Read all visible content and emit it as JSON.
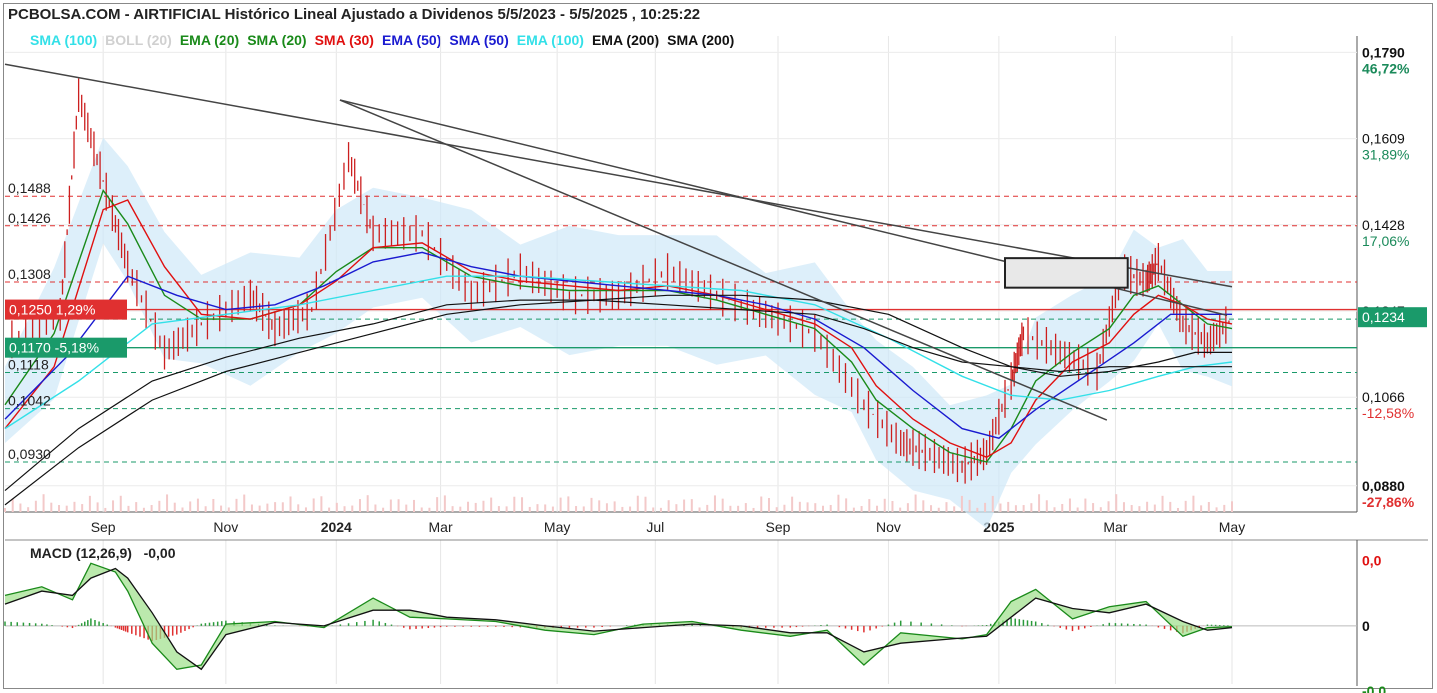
{
  "header": {
    "title": "PCBOLSA.COM - AIRTIFICIAL Histórico Lineal Ajustado a Dividenos 5/5/2023 - 5/5/2025 , 10:25:22"
  },
  "legend": [
    {
      "label": "SMA (100)",
      "color": "#33e0e8"
    },
    {
      "label": "BOLL (20)",
      "color": "#d0d0d0"
    },
    {
      "label": "EMA (20)",
      "color": "#1a8a1a"
    },
    {
      "label": "SMA (20)",
      "color": "#1a8a1a"
    },
    {
      "label": "SMA (30)",
      "color": "#e01010"
    },
    {
      "label": "EMA (50)",
      "color": "#1a1ad0"
    },
    {
      "label": "SMA (50)",
      "color": "#1a1ad0"
    },
    {
      "label": "EMA (100)",
      "color": "#33e0e8"
    },
    {
      "label": "EMA (200)",
      "color": "#111111"
    },
    {
      "label": "SMA (200)",
      "color": "#111111"
    }
  ],
  "macd": {
    "label": "MACD (12,26,9)",
    "value": "-0,00",
    "axis": [
      {
        "text": "0,0",
        "color": "#e01010",
        "level": 1
      },
      {
        "text": "0",
        "color": "#111111",
        "level": 0
      },
      {
        "text": "-0,0",
        "color": "#1a8a1a",
        "level": -1
      }
    ]
  },
  "chart_data": {
    "type": "line",
    "x_ticks": [
      "Sep",
      "Nov",
      "2024",
      "Mar",
      "May",
      "Jul",
      "Sep",
      "Nov",
      "2025",
      "Mar",
      "May"
    ],
    "x_tick_bold": [
      false,
      false,
      true,
      false,
      false,
      false,
      false,
      false,
      true,
      false,
      false
    ],
    "ylim": [
      0.0825,
      0.1795
    ],
    "right_labels": [
      {
        "value": 0.179,
        "text": "0,1790",
        "pct": "46,72%",
        "pct_color": "#1a8a5a"
      },
      {
        "value": 0.1609,
        "text": "0,1609",
        "pct": "31,89%",
        "pct_color": "#1a8a5a"
      },
      {
        "value": 0.1428,
        "text": "0,1428",
        "pct": "17,06%",
        "pct_color": "#1a8a5a"
      },
      {
        "value": 0.1247,
        "text": "0,1247",
        "pct": "",
        "pct_color": "#1a8a5a"
      },
      {
        "value": 0.1066,
        "text": "0,1066",
        "pct": "-12,58%",
        "pct_color": "#e03030"
      },
      {
        "value": 0.088,
        "text": "0,0880",
        "pct": "-27,86%",
        "pct_color": "#e03030"
      }
    ],
    "left_levels": [
      {
        "value": 0.1488,
        "text": "0,1488"
      },
      {
        "value": 0.1426,
        "text": "0,1426"
      },
      {
        "value": 0.1308,
        "text": "0,1308"
      },
      {
        "value": 0.1118,
        "text": "0,1118"
      },
      {
        "value": 0.1042,
        "text": "0,1042"
      },
      {
        "value": 0.093,
        "text": "0,0930"
      }
    ],
    "resistance_lines": [
      0.1488,
      0.1426,
      0.1308
    ],
    "support_lines": [
      0.123,
      0.1118,
      0.1042,
      0.093
    ],
    "current": {
      "value": 0.1234,
      "text": "0,1234",
      "color": "#1a9a6a"
    },
    "red_level": {
      "value": 0.125,
      "text": "0,1250 1,29%",
      "color": "#e03030"
    },
    "green_level": {
      "value": 0.117,
      "text": "0,1170 -5,18%",
      "color": "#1a9a6a"
    },
    "trendlines": [
      {
        "x": [
          0.0,
          1.0
        ],
        "y": [
          0.1765,
          0.1298
        ]
      },
      {
        "x": [
          0.273,
          0.898
        ],
        "y": [
          0.169,
          0.1018
        ]
      },
      {
        "x": [
          0.273,
          0.996
        ],
        "y": [
          0.169,
          0.1238
        ]
      }
    ],
    "box": {
      "x": [
        0.815,
        0.915
      ],
      "y": [
        0.1358,
        0.1296
      ]
    },
    "series": [
      {
        "name": "Precio",
        "kind": "price",
        "color": "#cc1f1f",
        "x": [
          0.0,
          0.045,
          0.06,
          0.08,
          0.1,
          0.13,
          0.16,
          0.2,
          0.22,
          0.25,
          0.28,
          0.3,
          0.34,
          0.38,
          0.42,
          0.46,
          0.5,
          0.54,
          0.58,
          0.62,
          0.66,
          0.7,
          0.73,
          0.75,
          0.78,
          0.8,
          0.82,
          0.83,
          0.86,
          0.89,
          0.91,
          0.93,
          0.94,
          0.96,
          0.98,
          1.0
        ],
        "y": [
          0.118,
          0.124,
          0.17,
          0.152,
          0.134,
          0.116,
          0.122,
          0.128,
          0.121,
          0.125,
          0.157,
          0.141,
          0.141,
          0.128,
          0.133,
          0.128,
          0.128,
          0.133,
          0.128,
          0.124,
          0.12,
          0.105,
          0.097,
          0.095,
          0.092,
          0.095,
          0.11,
          0.12,
          0.116,
          0.112,
          0.133,
          0.131,
          0.135,
          0.122,
          0.118,
          0.123
        ]
      },
      {
        "name": "EMA (20)",
        "kind": "ma",
        "color": "#1a8a1a",
        "width": 1.4,
        "x": [
          0.0,
          0.04,
          0.08,
          0.1,
          0.13,
          0.16,
          0.2,
          0.24,
          0.27,
          0.3,
          0.34,
          0.38,
          0.42,
          0.46,
          0.5,
          0.54,
          0.58,
          0.62,
          0.66,
          0.69,
          0.71,
          0.74,
          0.77,
          0.8,
          0.82,
          0.84,
          0.87,
          0.9,
          0.92,
          0.94,
          0.96,
          0.98,
          1.0
        ],
        "y": [
          0.105,
          0.12,
          0.15,
          0.143,
          0.128,
          0.123,
          0.123,
          0.126,
          0.133,
          0.138,
          0.138,
          0.132,
          0.13,
          0.129,
          0.129,
          0.129,
          0.127,
          0.124,
          0.121,
          0.114,
          0.106,
          0.1,
          0.095,
          0.093,
          0.1,
          0.11,
          0.116,
          0.121,
          0.128,
          0.13,
          0.126,
          0.122,
          0.121
        ]
      },
      {
        "name": "SMA (30)",
        "kind": "ma",
        "color": "#e01010",
        "width": 1.4,
        "x": [
          0.0,
          0.04,
          0.08,
          0.1,
          0.13,
          0.16,
          0.2,
          0.24,
          0.27,
          0.3,
          0.34,
          0.38,
          0.42,
          0.46,
          0.5,
          0.54,
          0.58,
          0.62,
          0.66,
          0.69,
          0.71,
          0.74,
          0.77,
          0.8,
          0.82,
          0.84,
          0.87,
          0.9,
          0.92,
          0.94,
          0.96,
          0.98,
          1.0
        ],
        "y": [
          0.1,
          0.113,
          0.146,
          0.148,
          0.134,
          0.124,
          0.123,
          0.126,
          0.131,
          0.138,
          0.139,
          0.133,
          0.131,
          0.13,
          0.129,
          0.13,
          0.128,
          0.125,
          0.122,
          0.117,
          0.109,
          0.102,
          0.097,
          0.094,
          0.097,
          0.106,
          0.114,
          0.118,
          0.124,
          0.128,
          0.126,
          0.123,
          0.122
        ]
      },
      {
        "name": "EMA (50)",
        "kind": "ma",
        "color": "#1a1ad0",
        "width": 1.4,
        "x": [
          0.0,
          0.05,
          0.1,
          0.14,
          0.18,
          0.22,
          0.26,
          0.3,
          0.34,
          0.38,
          0.42,
          0.46,
          0.5,
          0.54,
          0.58,
          0.62,
          0.66,
          0.7,
          0.74,
          0.78,
          0.81,
          0.84,
          0.88,
          0.92,
          0.95,
          0.98,
          1.0
        ],
        "y": [
          0.102,
          0.115,
          0.132,
          0.128,
          0.125,
          0.126,
          0.13,
          0.135,
          0.137,
          0.134,
          0.132,
          0.131,
          0.13,
          0.129,
          0.128,
          0.126,
          0.123,
          0.117,
          0.108,
          0.1,
          0.098,
          0.104,
          0.111,
          0.118,
          0.124,
          0.124,
          0.124
        ]
      },
      {
        "name": "EMA (100)",
        "kind": "ma",
        "color": "#33e0e8",
        "width": 1.4,
        "x": [
          0.0,
          0.06,
          0.12,
          0.18,
          0.24,
          0.3,
          0.36,
          0.42,
          0.48,
          0.54,
          0.6,
          0.66,
          0.72,
          0.78,
          0.82,
          0.86,
          0.9,
          0.94,
          0.97,
          1.0
        ],
        "y": [
          0.1,
          0.11,
          0.122,
          0.124,
          0.126,
          0.129,
          0.132,
          0.132,
          0.131,
          0.13,
          0.129,
          0.126,
          0.119,
          0.111,
          0.107,
          0.106,
          0.108,
          0.111,
          0.113,
          0.114
        ]
      },
      {
        "name": "SMA (200)",
        "kind": "ma",
        "color": "#111111",
        "width": 1.2,
        "x": [
          0.0,
          0.06,
          0.12,
          0.18,
          0.24,
          0.3,
          0.36,
          0.42,
          0.48,
          0.54,
          0.6,
          0.66,
          0.72,
          0.78,
          0.82,
          0.86,
          0.9,
          0.94,
          0.97,
          1.0
        ],
        "y": [
          0.084,
          0.096,
          0.106,
          0.112,
          0.116,
          0.12,
          0.124,
          0.126,
          0.127,
          0.128,
          0.128,
          0.127,
          0.124,
          0.117,
          0.113,
          0.111,
          0.112,
          0.114,
          0.116,
          0.116
        ]
      },
      {
        "name": "EMA (200)",
        "kind": "ma",
        "color": "#111111",
        "width": 1.2,
        "x": [
          0.0,
          0.06,
          0.12,
          0.18,
          0.24,
          0.3,
          0.36,
          0.42,
          0.48,
          0.54,
          0.6,
          0.66,
          0.7,
          0.74,
          0.78,
          0.82,
          0.86,
          0.9,
          0.94,
          0.97,
          1.0
        ],
        "y": [
          0.087,
          0.1,
          0.11,
          0.115,
          0.119,
          0.122,
          0.126,
          0.127,
          0.127,
          0.126,
          0.125,
          0.124,
          0.121,
          0.117,
          0.114,
          0.113,
          0.112,
          0.113,
          0.113,
          0.113,
          0.113
        ]
      }
    ],
    "macd_series": {
      "x": [
        0.0,
        0.03,
        0.055,
        0.07,
        0.09,
        0.1,
        0.12,
        0.14,
        0.16,
        0.18,
        0.22,
        0.26,
        0.3,
        0.33,
        0.36,
        0.4,
        0.44,
        0.48,
        0.52,
        0.56,
        0.6,
        0.64,
        0.67,
        0.7,
        0.73,
        0.78,
        0.8,
        0.82,
        0.84,
        0.87,
        0.9,
        0.93,
        0.96,
        0.98,
        1.0
      ],
      "macd": [
        0.35,
        0.45,
        0.3,
        0.72,
        0.62,
        0.4,
        -0.2,
        -0.5,
        -0.45,
        0.02,
        0.05,
        -0.02,
        0.32,
        0.1,
        0.08,
        0.05,
        -0.05,
        -0.1,
        0.02,
        0.05,
        -0.05,
        -0.12,
        -0.05,
        -0.45,
        -0.08,
        -0.15,
        -0.1,
        0.28,
        0.42,
        0.08,
        0.22,
        0.28,
        -0.12,
        -0.02,
        -0.01
      ],
      "signal": [
        0.25,
        0.4,
        0.35,
        0.55,
        0.66,
        0.55,
        0.15,
        -0.3,
        -0.5,
        -0.1,
        0.04,
        0.0,
        0.18,
        0.18,
        0.1,
        0.07,
        0.0,
        -0.06,
        -0.02,
        0.02,
        0.0,
        -0.08,
        -0.08,
        -0.3,
        -0.2,
        -0.14,
        -0.12,
        0.1,
        0.32,
        0.2,
        0.15,
        0.25,
        0.05,
        -0.05,
        -0.02
      ],
      "ylim": [
        -0.6,
        0.85
      ]
    }
  }
}
